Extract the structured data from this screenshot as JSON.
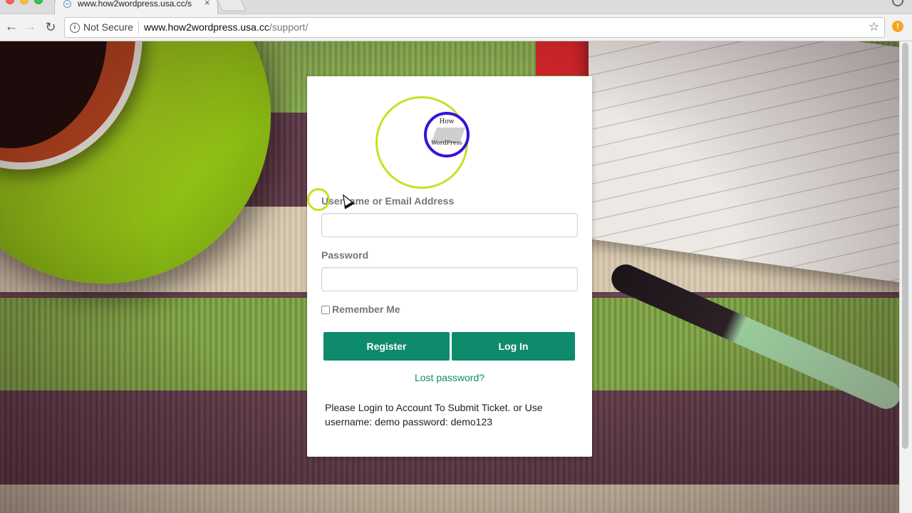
{
  "browser": {
    "tab_title": "www.how2wordpress.usa.cc/s",
    "tab_close": "×",
    "security_label": "Not Secure",
    "info_icon": "i",
    "url_host": "www.how2wordpress.usa.cc",
    "url_path": "/support/",
    "back": "←",
    "forward": "→",
    "reload": "↻",
    "star": "☆",
    "extension_badge": "!"
  },
  "login": {
    "logo_line1": "How",
    "logo_line2": "WordPress",
    "username_label": "Username or Email Address",
    "username_value": "",
    "password_label": "Password",
    "password_value": "",
    "remember_label": "Remember Me",
    "remember_checked": false,
    "register_button": "Register",
    "login_button": "Log In",
    "lost_password": "Lost password?",
    "notice": "Please Login to Account To Submit Ticket. or Use username: demo password: demo123"
  },
  "colors": {
    "accent": "#0e8a6d",
    "label": "#72777c",
    "cursor_highlight": "#c8e022",
    "logo_ring": "#3a10d8"
  }
}
